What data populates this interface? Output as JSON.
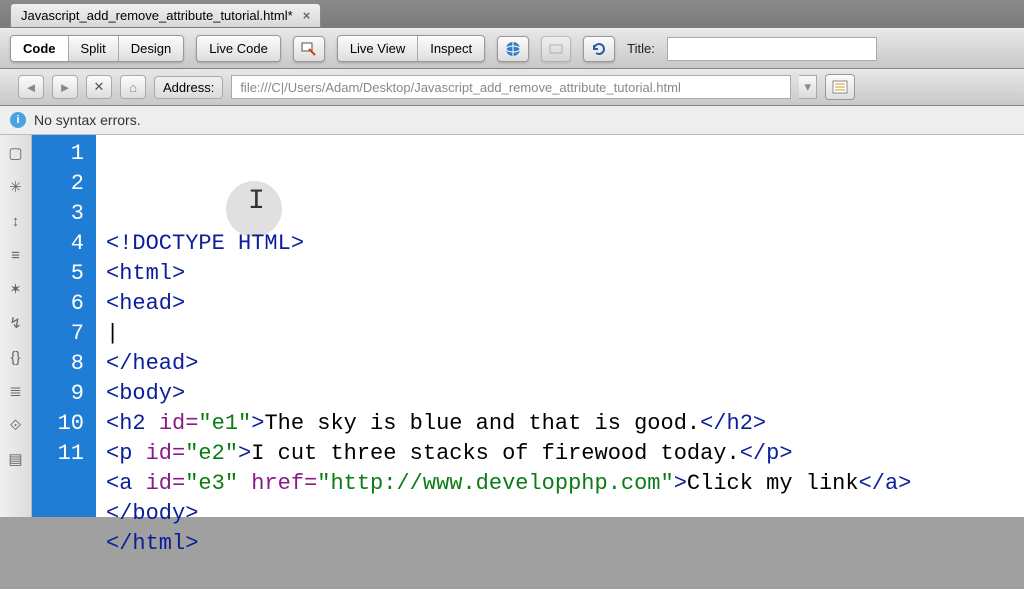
{
  "tab": {
    "title": "Javascript_add_remove_attribute_tutorial.html*",
    "close": "×"
  },
  "toolbar": {
    "code": "Code",
    "split": "Split",
    "design": "Design",
    "liveCode": "Live Code",
    "liveView": "Live View",
    "inspect": "Inspect",
    "titleLabel": "Title:",
    "titleValue": ""
  },
  "address": {
    "label": "Address:",
    "value": "file:///C|/Users/Adam/Desktop/Javascript_add_remove_attribute_tutorial.html"
  },
  "status": {
    "icon": "i",
    "text": "No syntax errors."
  },
  "code": {
    "lines": [
      "1",
      "2",
      "3",
      "4",
      "5",
      "6",
      "7",
      "8",
      "9",
      "10",
      "11"
    ],
    "l1": "<!DOCTYPE HTML>",
    "l2": "<html>",
    "l3": "<head>",
    "l4_caret": "|",
    "l5": "</head>",
    "l6": "<body>",
    "l7": {
      "open": "<h2 ",
      "attr": "id=",
      "val": "\"e1\"",
      "close": ">",
      "text": "The sky is blue and that is good.",
      "end": "</h2>"
    },
    "l8": {
      "open": "<p ",
      "attr": "id=",
      "val": "\"e2\"",
      "close": ">",
      "text": "I cut three stacks of firewood today.",
      "end": "</p>"
    },
    "l9": {
      "open": "<a ",
      "attr1": "id=",
      "val1": "\"e3\" ",
      "attr2": "href=",
      "val2": "\"http://www.developphp.com\"",
      "close": ">",
      "text": "Click my link",
      "end": "</a>"
    },
    "l10": "</body>",
    "l11": "</html>"
  }
}
